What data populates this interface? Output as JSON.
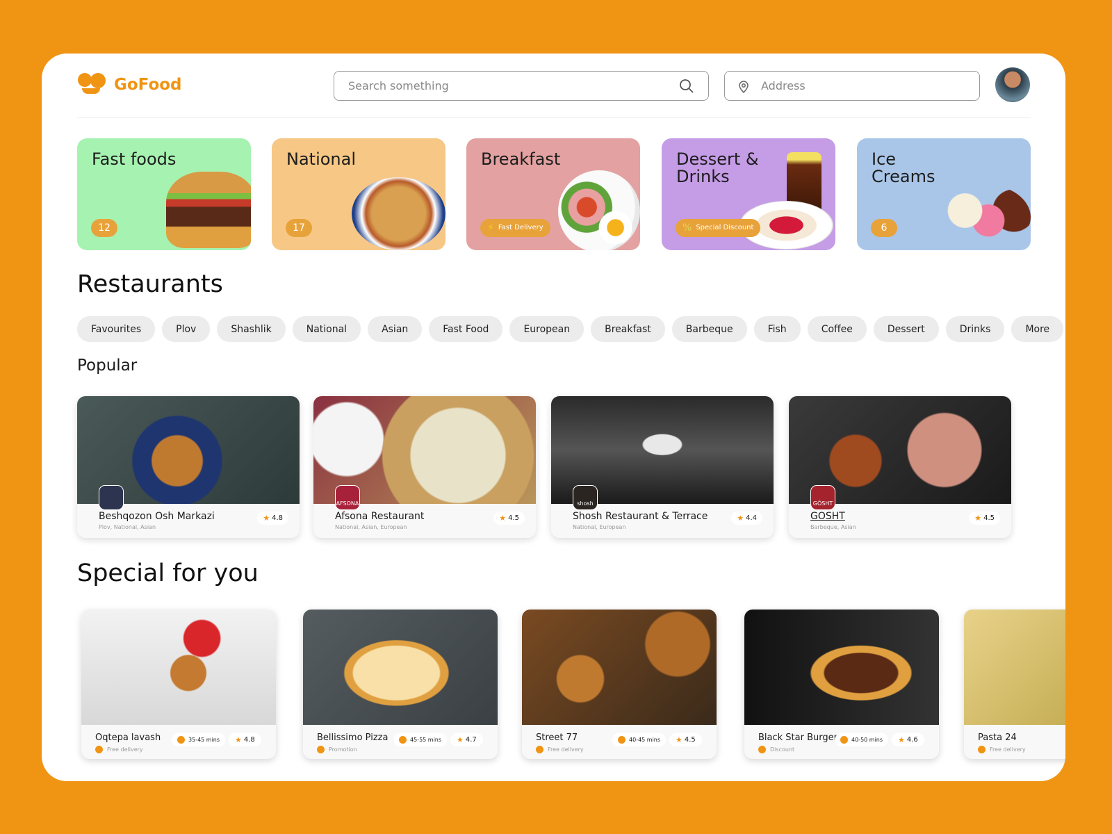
{
  "header": {
    "brand": "GoFood",
    "search_placeholder": "Search something",
    "address_placeholder": "Address"
  },
  "categories": [
    {
      "title": "Fast foods",
      "badge": "12",
      "color": "#A6F2B1"
    },
    {
      "title": "National",
      "badge": "17",
      "color": "#F6C785"
    },
    {
      "title": "Breakfast",
      "badge": "Fast Delivery",
      "badge_icon": "lightning-icon",
      "color": "#E3A1A1"
    },
    {
      "title": "Dessert & Drinks",
      "badge": "Special Discount",
      "badge_icon": "percent-icon",
      "color": "#C59CE6"
    },
    {
      "title": "Ice Creams",
      "badge": "6",
      "color": "#A9C6E8"
    }
  ],
  "restaurants": {
    "title": "Restaurants",
    "filters": [
      "Favourites",
      "Plov",
      "Shashlik",
      "National",
      "Asian",
      "Fast Food",
      "European",
      "Breakfast",
      "Barbeque",
      "Fish",
      "Coffee",
      "Dessert",
      "Drinks",
      "More"
    ]
  },
  "popular": {
    "title": "Popular",
    "items": [
      {
        "name": "Beshqozon Osh Markazi",
        "tags": "Plov, National, Asian",
        "rating": "4.8",
        "logo": "",
        "logo_color": "#2d3450"
      },
      {
        "name": "Afsona Restaurant",
        "tags": "National, Asian, European",
        "rating": "4.5",
        "logo": "AFSONA",
        "logo_color": "#a8213a"
      },
      {
        "name": "Shosh Restaurant & Terrace",
        "tags": "National, European",
        "rating": "4.4",
        "logo": "shosh",
        "logo_color": "#2a2520"
      },
      {
        "name": "GOSHT",
        "tags": "Barbeque, Asian",
        "rating": "4.5",
        "logo": "GÖSHT",
        "logo_color": "#a5232d"
      }
    ]
  },
  "special": {
    "title": "Special for you",
    "items": [
      {
        "name": "Oqtepa lavash",
        "perk": "Free delivery",
        "time": "35-45 mins",
        "rating": "4.8"
      },
      {
        "name": "Bellissimo Pizza",
        "perk": "Promotion",
        "time": "45-55 mins",
        "rating": "4.7"
      },
      {
        "name": "Street 77",
        "perk": "Free delivery",
        "time": "40-45 mins",
        "rating": "4.5"
      },
      {
        "name": "Black Star Burger",
        "perk": "Discount",
        "time": "40-50 mins",
        "rating": "4.6"
      },
      {
        "name": "Pasta 24",
        "perk": "Free delivery",
        "time": "",
        "rating": ""
      }
    ]
  },
  "colors": {
    "accent": "#F09413"
  }
}
